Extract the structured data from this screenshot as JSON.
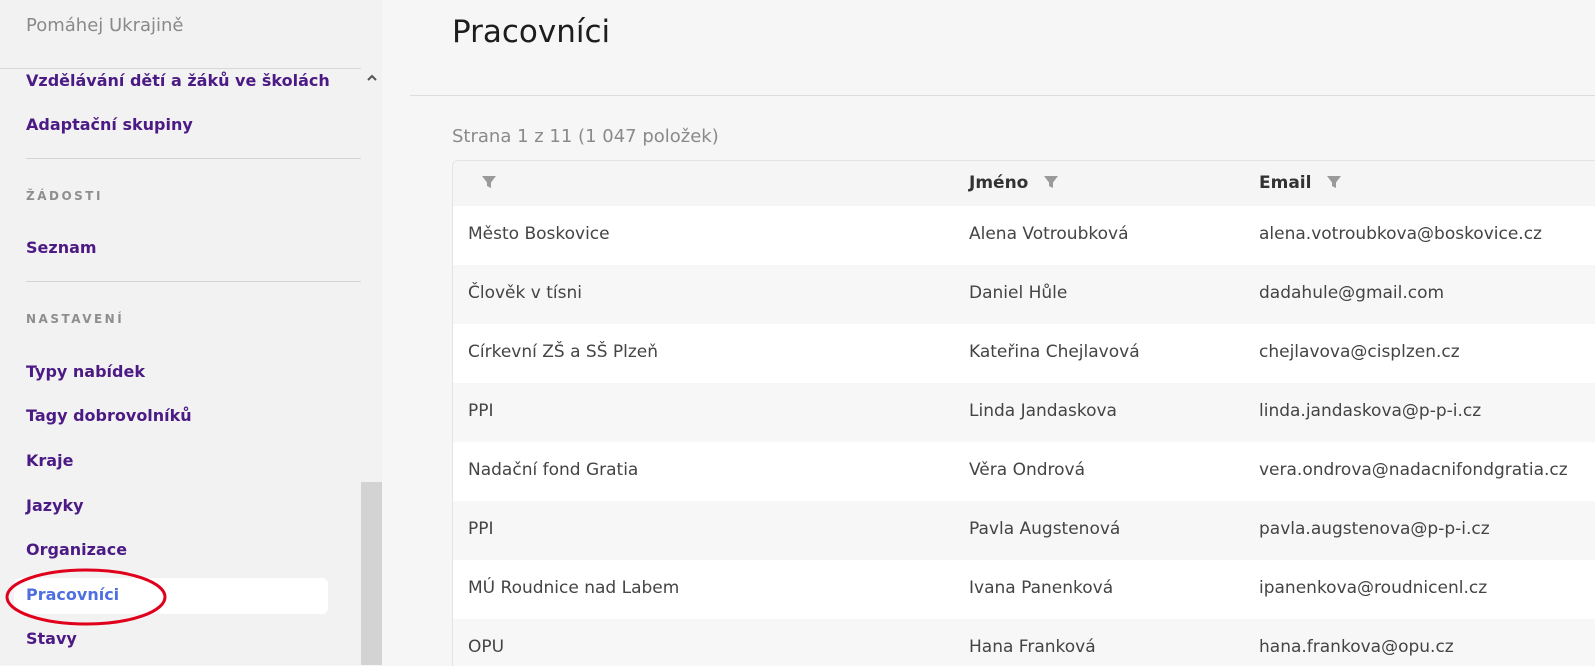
{
  "sidebar": {
    "brand": "Pomáhej Ukrajině",
    "links_top": [
      "Vzdělávání dětí a žáků ve školách",
      "Adaptační skupiny"
    ],
    "section_requests": "ŽÁDOSTI",
    "requests_links": [
      "Seznam"
    ],
    "section_settings": "NASTAVENÍ",
    "settings_links": [
      "Typy nabídek",
      "Tagy dobrovolníků",
      "Kraje",
      "Jazyky",
      "Organizace",
      "Pracovníci",
      "Stavy"
    ],
    "active_link": "Pracovníci",
    "highlight_color": "#e0001b"
  },
  "main": {
    "title": "Pracovníci",
    "pager_text": "Strana 1 z 11 (1 047 položek)",
    "columns": [
      "",
      "Jméno",
      "Email"
    ],
    "rows": [
      [
        "Město Boskovice",
        "Alena Votroubková",
        "alena.votroubkova@boskovice.cz"
      ],
      [
        "Člověk v tísni",
        "Daniel Hůle",
        "dadahule@gmail.com"
      ],
      [
        "Církevní ZŠ a SŠ Plzeň",
        "Kateřina Chejlavová",
        "chejlavova@cisplzen.cz"
      ],
      [
        "PPI",
        "Linda Jandaskova",
        "linda.jandaskova@p-p-i.cz"
      ],
      [
        "Nadační fond Gratia",
        "Věra Ondrová",
        "vera.ondrova@nadacnifondgratia.cz"
      ],
      [
        "PPI",
        "Pavla Augstenová",
        "pavla.augstenova@p-p-i.cz"
      ],
      [
        "MÚ Roudnice nad Labem",
        "Ivana Panenková",
        "ipanenkova@roudnicenl.cz"
      ],
      [
        "OPU",
        "Hana Franková",
        "hana.frankova@opu.cz"
      ]
    ]
  },
  "colors": {
    "nav": "#4b1a84",
    "active": "#4f6fe0"
  }
}
